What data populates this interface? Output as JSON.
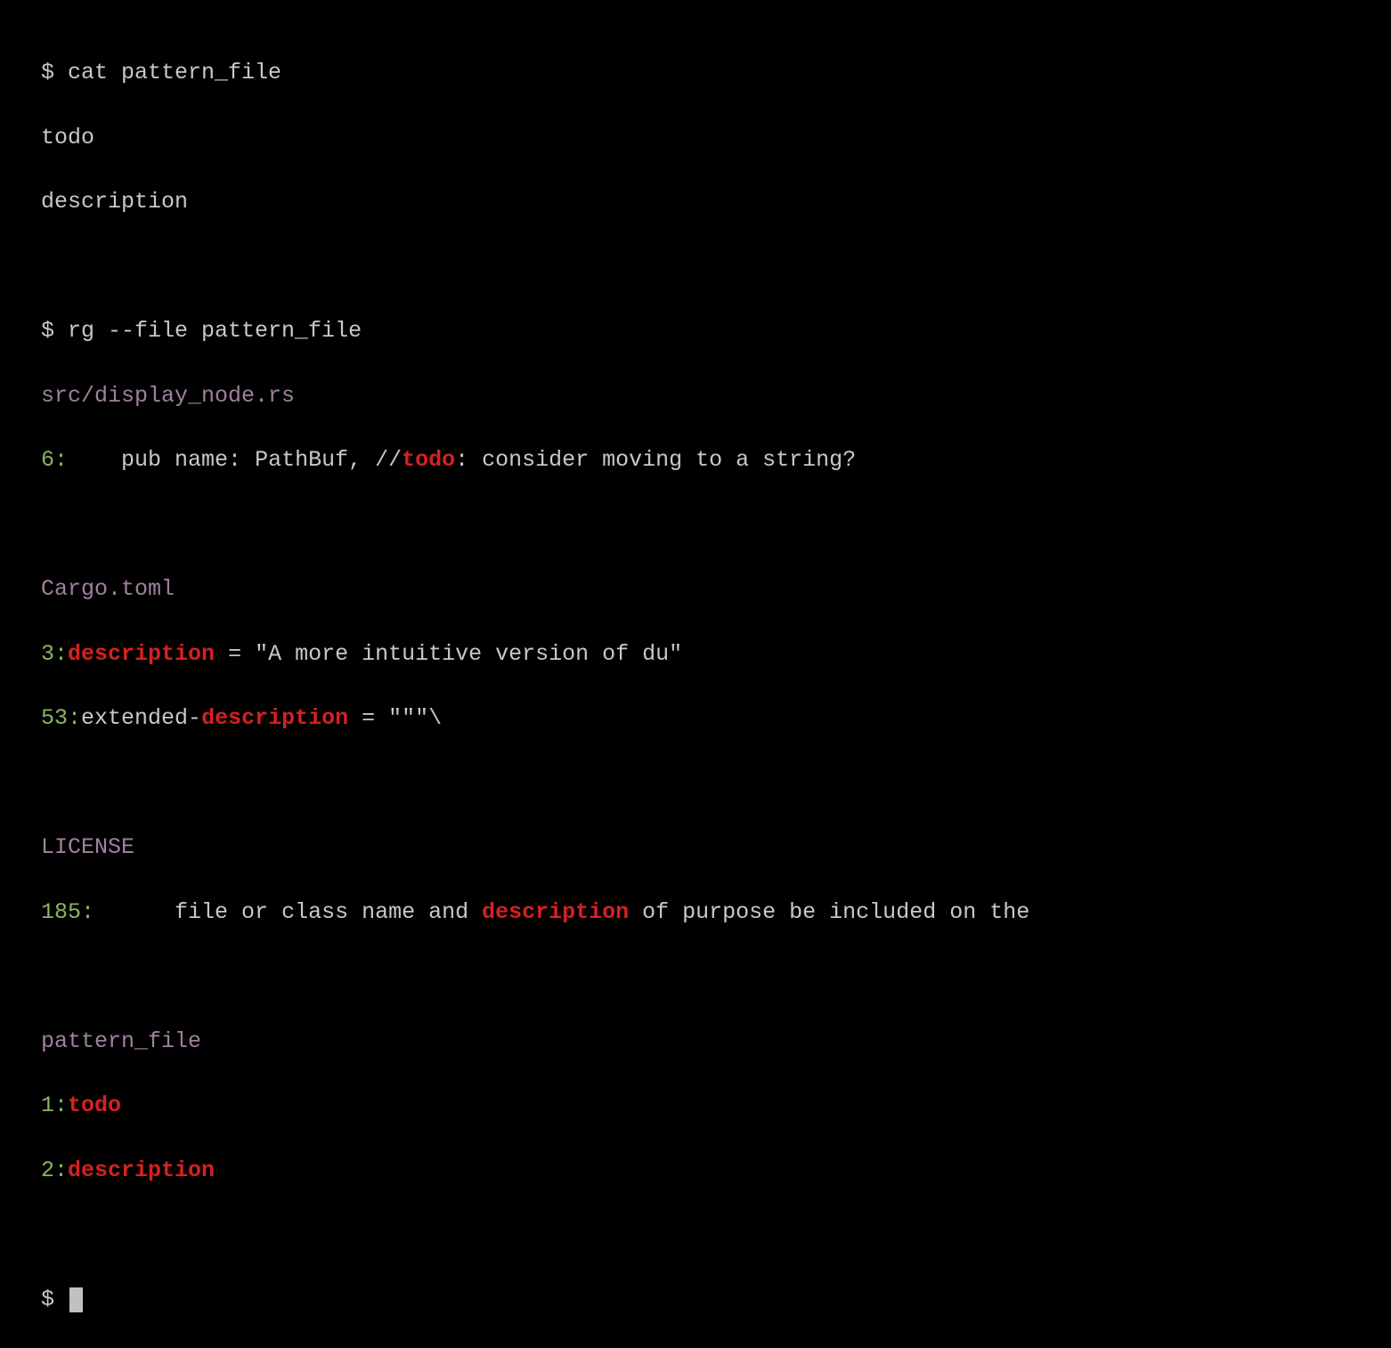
{
  "prompt": "$ ",
  "commands": {
    "cat": "cat pattern_file",
    "rg": "rg --file pattern_file"
  },
  "cat_output": {
    "line1": "todo",
    "line2": "description"
  },
  "results": {
    "file1": {
      "path": "src/display_node.rs",
      "match1": {
        "num": "6",
        "colon": ":",
        "pre": "    pub name: PathBuf, //",
        "hit": "todo",
        "post": ": consider moving to a string?"
      }
    },
    "file2": {
      "path": "Cargo.toml",
      "match1": {
        "num": "3",
        "colon": ":",
        "pre": "",
        "hit": "description",
        "post": " = \"A more intuitive version of du\""
      },
      "match2": {
        "num": "53",
        "colon": ":",
        "pre": "extended-",
        "hit": "description",
        "post": " = \"\"\"\\"
      }
    },
    "file3": {
      "path": "LICENSE",
      "match1": {
        "num": "185",
        "colon": ":",
        "pre": "      file or class name and ",
        "hit": "description",
        "post": " of purpose be included on the"
      }
    },
    "file4": {
      "path": "pattern_file",
      "match1": {
        "num": "1",
        "colon": ":",
        "pre": "",
        "hit": "todo",
        "post": ""
      },
      "match2": {
        "num": "2",
        "colon": ":",
        "pre": "",
        "hit": "description",
        "post": ""
      }
    }
  }
}
